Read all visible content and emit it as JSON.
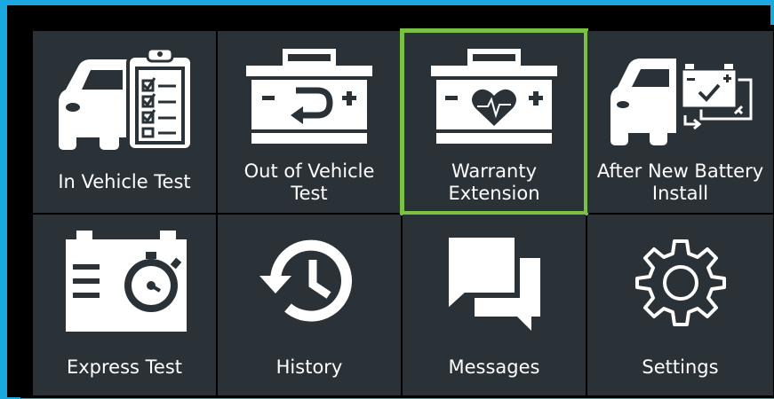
{
  "tiles": [
    {
      "label": "In Vehicle Test",
      "icon": "car-clipboard-icon",
      "selected": false
    },
    {
      "label": "Out of Vehicle\nTest",
      "icon": "battery-return-icon",
      "selected": false
    },
    {
      "label": "Warranty\nExtension",
      "icon": "battery-heart-icon",
      "selected": true
    },
    {
      "label": "After New Battery\nInstall",
      "icon": "car-battery-swap-icon",
      "selected": false
    },
    {
      "label": "Express Test",
      "icon": "battery-stopwatch-icon",
      "selected": false
    },
    {
      "label": "History",
      "icon": "history-icon",
      "selected": false
    },
    {
      "label": "Messages",
      "icon": "messages-icon",
      "selected": false
    },
    {
      "label": "Settings",
      "icon": "gear-icon",
      "selected": false
    }
  ],
  "colors": {
    "frame": "#1aa8e0",
    "tile": "#2a3137",
    "selection": "#7ac043"
  }
}
